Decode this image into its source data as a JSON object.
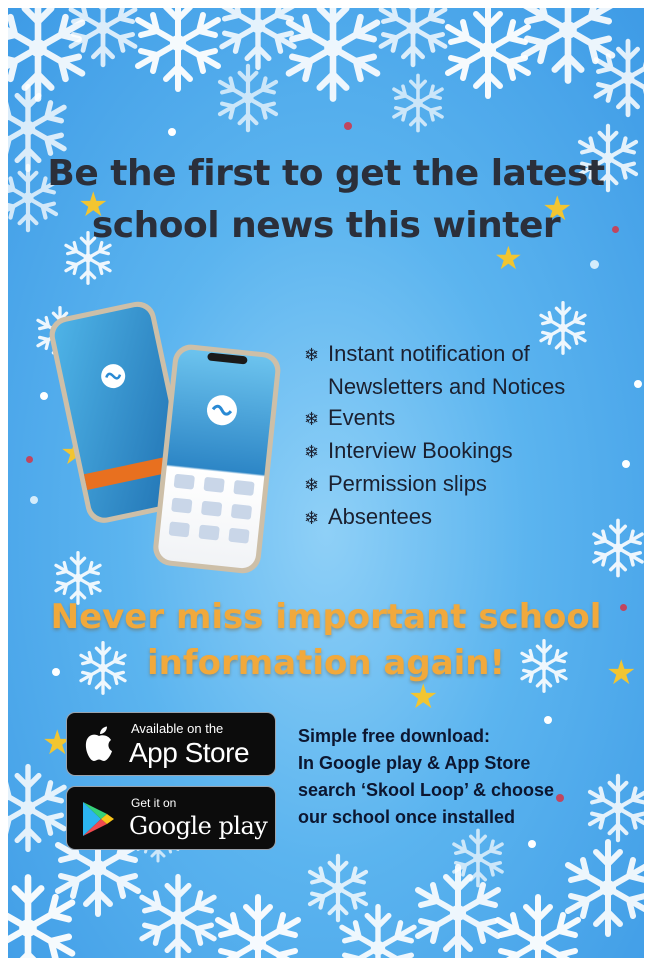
{
  "headline": {
    "line1": "Be the first to get the latest",
    "line2": "school news this winter"
  },
  "features": {
    "bullet": "❄",
    "items": [
      "Instant notification of",
      "Newsletters and Notices",
      "Events",
      "Interview Bookings",
      "Permission slips",
      "Absentees"
    ]
  },
  "tagline": {
    "line1": "Never miss important school",
    "line2": "information again!"
  },
  "app_store": {
    "small": "Available on the",
    "big": "App Store"
  },
  "google_play": {
    "small": "Get it on",
    "big": "Google play"
  },
  "download": {
    "lines": [
      "Simple free download:",
      "In Google play & App Store",
      "search ‘Skool Loop’ & choose",
      "our school once installed"
    ]
  },
  "colors": {
    "background": "#4aa8ec",
    "headline": "#2b2f3a",
    "tagline": "#f1a93c",
    "star": "#f2c531",
    "button": "#0c0c0c"
  },
  "icons": [
    "snowflake-icon",
    "star-icon",
    "apple-logo-icon",
    "google-play-logo-icon",
    "phone-mockup"
  ]
}
